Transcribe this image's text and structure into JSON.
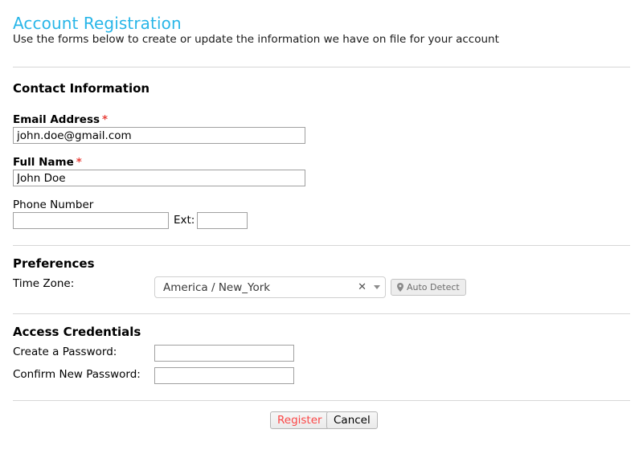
{
  "header": {
    "title": "Account Registration",
    "subtitle": "Use the forms below to create or update the information we have on file for your account"
  },
  "sections": {
    "contact": {
      "heading": "Contact Information",
      "fields": {
        "email": {
          "label": "Email Address",
          "required_marker": "*",
          "value": "john.doe@gmail.com",
          "placeholder": ""
        },
        "full_name": {
          "label": "Full Name",
          "required_marker": "*",
          "value": "John Doe",
          "placeholder": ""
        },
        "phone": {
          "label": "Phone Number",
          "value": "",
          "placeholder": ""
        },
        "extension": {
          "label": "Ext:",
          "value": "",
          "placeholder": ""
        }
      }
    },
    "preferences": {
      "heading": "Preferences",
      "timezone": {
        "label": "Time Zone:",
        "selected": "America / New_York",
        "clear_glyph": "✕",
        "auto_detect_label": "Auto Detect",
        "auto_detect_icon": "map-marker-icon"
      }
    },
    "access": {
      "heading": "Access Credentials",
      "fields": {
        "password": {
          "label": "Create a Password:",
          "value": "",
          "placeholder": ""
        },
        "confirm_password": {
          "label": "Confirm New Password:",
          "value": "",
          "placeholder": ""
        }
      }
    }
  },
  "footer": {
    "register_label": "Register",
    "cancel_label": "Cancel"
  },
  "colors": {
    "title": "#29b6e8",
    "required_asterisk": "#e8413a",
    "register_text": "#fb4646",
    "divider": "#d7d7d7"
  }
}
